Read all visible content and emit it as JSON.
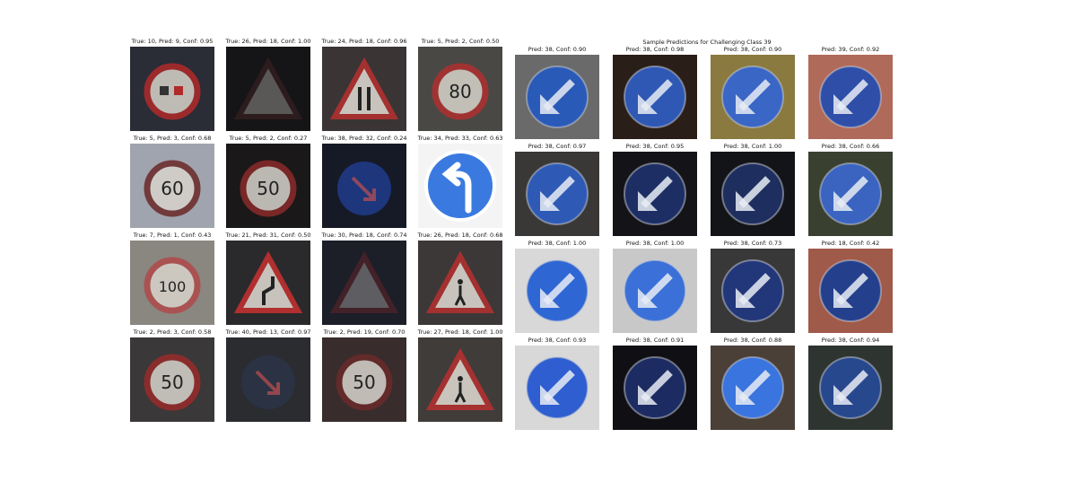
{
  "figure": {
    "right_title": "Sample Predictions for Challenging Class 39",
    "left_panels": [
      [
        {
          "caption": "True: 10, Pred: 9, Conf: 0.95",
          "bg": "#2a2c36",
          "sign": "nopass",
          "ring": "#b02a2a"
        },
        {
          "caption": "True: 26, Pred: 18, Conf: 1.00",
          "bg": "#151518",
          "sign": "triangle-dark",
          "ring": "#5a2a2a"
        },
        {
          "caption": "True: 24, Pred: 18, Conf: 0.96",
          "bg": "#3a3434",
          "sign": "triangle-narrow",
          "ring": "#b03030"
        },
        {
          "caption": "True: 5, Pred: 2, Conf: 0.50",
          "bg": "#4a4844",
          "sign": "speed",
          "text": "80",
          "ring": "#b03030"
        }
      ],
      [
        {
          "caption": "True: 5, Pred: 3, Conf: 0.68",
          "bg": "#a0a4ae",
          "sign": "speed",
          "text": "60",
          "ring": "#6a2828"
        },
        {
          "caption": "True: 5, Pred: 2, Conf: 0.27",
          "bg": "#1a1818",
          "sign": "speed",
          "text": "50",
          "ring": "#8a2a2a"
        },
        {
          "caption": "True: 38, Pred: 32, Conf: 0.24",
          "bg": "#161a26",
          "sign": "blue-dark",
          "ring": "#1e3a86"
        },
        {
          "caption": "True: 34, Pred: 33, Conf: 0.63",
          "bg": "#f4f4f4",
          "sign": "blue-left",
          "ring": "#3a7ae0"
        }
      ],
      [
        {
          "caption": "True: 7, Pred: 1, Conf: 0.43",
          "bg": "#8a8680",
          "sign": "speed",
          "text": "100",
          "ring": "#b04a4a"
        },
        {
          "caption": "True: 21, Pred: 31, Conf: 0.50",
          "bg": "#2a2a2c",
          "sign": "triangle-curve",
          "ring": "#c03030"
        },
        {
          "caption": "True: 30, Pred: 18, Conf: 0.74",
          "bg": "#1c1e28",
          "sign": "triangle-dark",
          "ring": "#8a2828"
        },
        {
          "caption": "True: 26, Pred: 18, Conf: 0.68",
          "bg": "#3c3838",
          "sign": "triangle-person",
          "ring": "#b03030"
        }
      ],
      [
        {
          "caption": "True: 2, Pred: 3, Conf: 0.58",
          "bg": "#3a3838",
          "sign": "speed",
          "text": "50",
          "ring": "#9a2a2a"
        },
        {
          "caption": "True: 40, Pred: 13, Conf: 0.97",
          "bg": "#2a2c30",
          "sign": "round-blue",
          "ring": "#2a3a5a"
        },
        {
          "caption": "True: 2, Pred: 19, Conf: 0.70",
          "bg": "#382c2c",
          "sign": "speed",
          "text": "50",
          "ring": "#6a2a2a"
        },
        {
          "caption": "True: 27, Pred: 18, Conf: 1.00",
          "bg": "#403c3a",
          "sign": "triangle-person",
          "ring": "#b03030"
        }
      ]
    ],
    "right_panels": [
      [
        {
          "caption": "Pred: 38, Conf: 0.90",
          "bg": "#6a6a6a",
          "tone": "#2a5ab8"
        },
        {
          "caption": "Pred: 38, Conf: 0.98",
          "bg": "#2a1e18",
          "tone": "#2e58b4"
        },
        {
          "caption": "Pred: 38, Conf: 0.90",
          "bg": "#8a7a40",
          "tone": "#3a66c6"
        },
        {
          "caption": "Pred: 39, Conf: 0.92",
          "bg": "#b06a5a",
          "tone": "#2e4ea8"
        }
      ],
      [
        {
          "caption": "Pred: 38, Conf: 0.97",
          "bg": "#3a3836",
          "tone": "#2e5ab6"
        },
        {
          "caption": "Pred: 38, Conf: 0.95",
          "bg": "#141418",
          "tone": "#1c2e64"
        },
        {
          "caption": "Pred: 38, Conf: 1.00",
          "bg": "#121418",
          "tone": "#1e2e5e"
        },
        {
          "caption": "Pred: 38, Conf: 0.66",
          "bg": "#3a4030",
          "tone": "#3a64c0"
        }
      ],
      [
        {
          "caption": "Pred: 38, Conf: 1.00",
          "bg": "#d8d8d8",
          "tone": "#2e66d4"
        },
        {
          "caption": "Pred: 38, Conf: 1.00",
          "bg": "#c8c8c8",
          "tone": "#3a70d8"
        },
        {
          "caption": "Pred: 38, Conf: 0.73",
          "bg": "#383838",
          "tone": "#22367a"
        },
        {
          "caption": "Pred: 18, Conf: 0.42",
          "bg": "#a05a4a",
          "tone": "#24408c"
        }
      ],
      [
        {
          "caption": "Pred: 38, Conf: 0.93",
          "bg": "#d8d8d8",
          "tone": "#2e5ed0"
        },
        {
          "caption": "Pred: 38, Conf: 0.91",
          "bg": "#101014",
          "tone": "#1c2c62"
        },
        {
          "caption": "Pred: 38, Conf: 0.88",
          "bg": "#4a4038",
          "tone": "#3a74de"
        },
        {
          "caption": "Pred: 38, Conf: 0.94",
          "bg": "#2e3430",
          "tone": "#28488e"
        }
      ]
    ]
  }
}
